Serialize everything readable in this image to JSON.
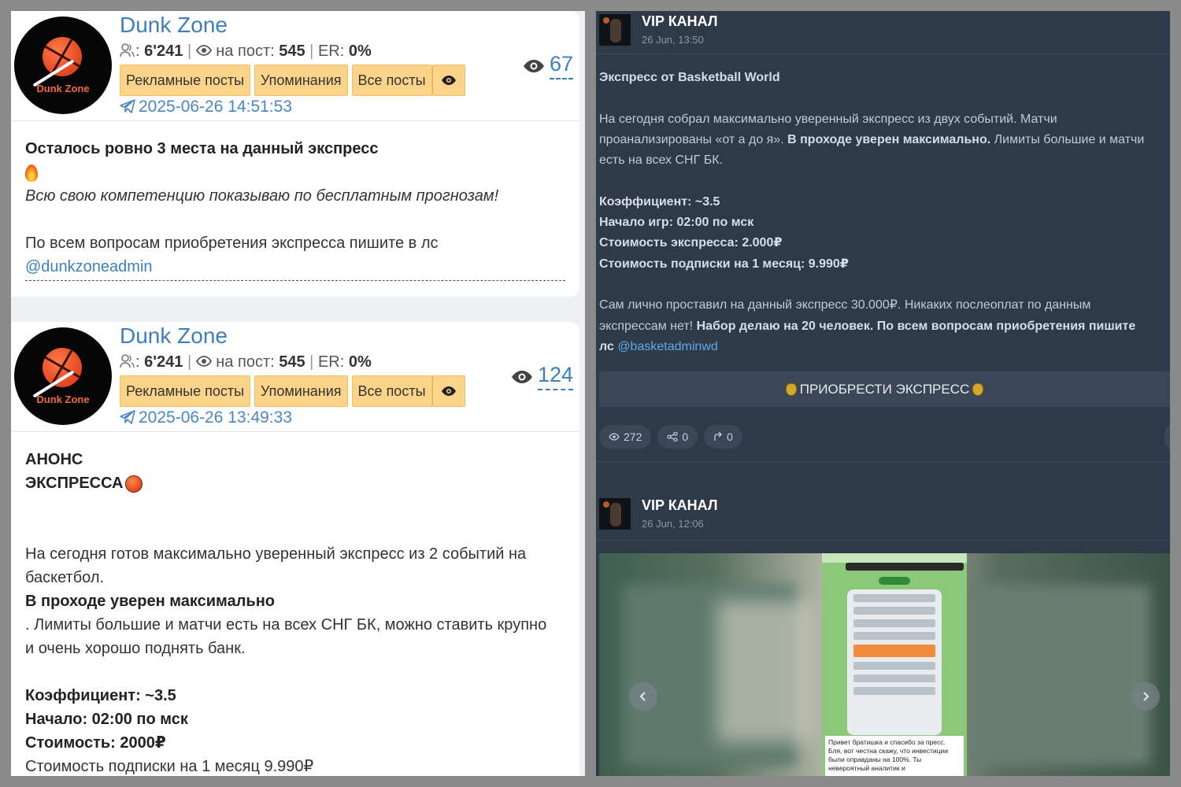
{
  "left_posts": [
    {
      "channel_name": "Dunk Zone",
      "avatar_text": "Dunk Zone",
      "subscribers": "6'241",
      "per_post_label": "на пост:",
      "per_post": "545",
      "er_label": "ER:",
      "er": "0%",
      "buttons": [
        "Рекламные посты",
        "Упоминания",
        "Все посты"
      ],
      "date": "2025-06-26 14:51:53",
      "views": "67",
      "body": {
        "line1": "Осталось ровно 3 места на данный экспресс",
        "line2": "Всю свою компетенцию показываю по бесплатным прогнозам!",
        "line3": "По всем вопросам приобретения экспресса пишите в лс",
        "link": "@dunkzoneadmin"
      }
    },
    {
      "channel_name": "Dunk Zone",
      "avatar_text": "Dunk Zone",
      "subscribers": "6'241",
      "per_post_label": "на пост:",
      "per_post": "545",
      "er_label": "ER:",
      "er": "0%",
      "buttons": [
        "Рекламные посты",
        "Упоминания",
        "Все посты"
      ],
      "date": "2025-06-26 13:49:33",
      "views": "124",
      "body": {
        "line1": "АНОНС",
        "line2": "ЭКСПРЕССА",
        "line3": "На сегодня готов максимально уверенный экспресс из 2 событий на",
        "line4": "баскетбол.",
        "line5": "В проходе уверен максимально",
        "line6": ". Лимиты большие и матчи есть на всех СНГ БК, можно ставить крупно",
        "line7": "и очень хорошо поднять банк.",
        "line8": "Коэффициент: ~3.5",
        "line9": "Начало: 02:00 по мск",
        "line10": "Стоимость: 2000₽",
        "line11": "Стоимость подписки на 1 месяц 9.990₽"
      }
    }
  ],
  "right_posts": [
    {
      "channel_name": "VIP КАНАЛ",
      "date": "26 Jun, 13:50",
      "title": "Экспресс от Basketball World",
      "p1_a": "На сегодня собрал максимально уверенный экспресс из двух событий. Матчи",
      "p1_b": "проанализированы «от а до я».",
      "p1_b_bold": "В проходе уверен максимально.",
      "p1_b_end": "Лимиты большие и матчи",
      "p1_c": "есть на всех СНГ БК.",
      "coef": "Коэффициент: ~3.5",
      "start": "Начало игр: 02:00 по мск",
      "price": "Стоимость экспресса: 2.000₽",
      "sub_price": "Стоимость подписки на 1 месяц: 9.990₽",
      "p3_a": "Сам лично проставил на данный экспресс 30.000₽. Никаких послеоплат по данным",
      "p3_b": "экспрессам нет!",
      "p3_b_bold": "Набор делаю на 20 человек. По всем вопросам приобретения пишите",
      "p3_c_bold": "лс",
      "link": "@basketadminwd",
      "buy_button": "ПРИОБРЕСТИ ЭКСПРЕСС",
      "views": "272",
      "shares": "0",
      "forwards": "0"
    },
    {
      "channel_name": "VIP КАНАЛ",
      "date": "26 Jun, 12:06",
      "phone_caption": "Привет братишка и спасибо за пресс. Бля, вот честна скажу, что инвестиции были оправданы на 100%. Ты невероятный аналитик и"
    }
  ],
  "icons": {
    "subscribers": "users-icon",
    "views": "eye-icon",
    "date": "telegram-plane-icon",
    "share": "share-icon",
    "forward": "forward-icon",
    "prev": "chevron-left-icon",
    "next": "chevron-right-icon"
  },
  "colors": {
    "accent_blue": "#3d7fbd",
    "button_yellow": "#fbd48a",
    "dark_panel": "#2f3a48",
    "link_blue": "#5fa9e6"
  }
}
